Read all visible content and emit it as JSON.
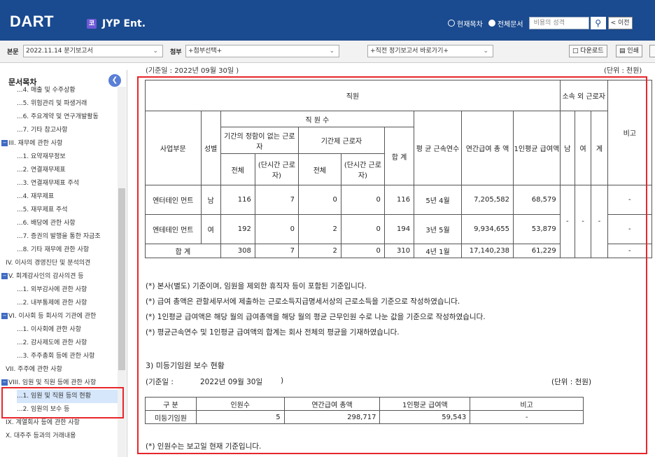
{
  "header": {
    "logo": "DART",
    "company": "JYP Ent.",
    "company_icon": "코",
    "radio1": "현재목차",
    "radio2": "전체문서",
    "search_placeholder": "비용의 성격",
    "prev_label": "< 이전"
  },
  "toolbar": {
    "main_label": "본문",
    "main_value": "2022.11.14  분기보고서",
    "attach_label": "첨부",
    "attach_value": "+첨부선택+",
    "recent_value": "+직전 정기보고서 바로가기+",
    "download": "다운로드",
    "print": "인쇄"
  },
  "sidebar": {
    "title": "문서목차",
    "items": [
      "...4. 매출 및 수주상황",
      "...5. 위험관리 및 파생거래",
      "...6. 주요계약 및 연구개발활동",
      "...7. 기타 참고사항",
      "III. 재무에 관한 사항",
      "...1. 요약재무정보",
      "...2. 연결재무제표",
      "...3. 연결재무제표 주석",
      "...4. 재무제표",
      "...5. 재무제표 주석",
      "...6. 배당에 관한 사항",
      "...7. 증권의 발행을 통한 자금조",
      "...8. 기타 재무에 관한 사항",
      "IV. 이사의 경영진단 및 분석의견",
      "V. 회계감사인의 감사의견 등",
      "...1. 외부감사에 관한 사항",
      "...2. 내부통제에 관한 사항",
      "VI. 이사회 등 회사의 기관에 관한",
      "...1. 이사회에 관한 사항",
      "...2. 감사제도에 관한 사항",
      "...3. 주주총회 등에 관한 사항",
      "VII. 주주에 관한 사항",
      "VIII. 임원 및 직원 등에 관한 사항",
      "...1. 임원 및 직원 등의 현황",
      "...2. 임원의 보수 등",
      "IX. 계열회사 등에 관한 사항",
      "X. 대주주 등과의 거래내용"
    ]
  },
  "top_partial": {
    "left": "(기준일 :  2022년 09월 30일 )",
    "right": "(단위 : 천원)"
  },
  "staff": {
    "h_staff": "직원",
    "h_outside": "소속 외 근로자",
    "h_remark": "비고",
    "h_count": "직 원 수",
    "h_div": "사업부문",
    "h_gender": "성별",
    "h_nofixed": "기간의 정함이 없는 근로자",
    "h_fixed": "기간제 근로자",
    "h_total": "합 계",
    "h_tenure": "평 균 근속연수",
    "h_annual": "연간급여 총 액",
    "h_avg": "1인평균 급여액",
    "h_male": "남",
    "h_female": "여",
    "h_sum": "계",
    "h_all": "전체",
    "h_part": "(단시간 근로자)",
    "rows": [
      {
        "div": "엔터테인 먼트",
        "gender": "남",
        "nf_all": "116",
        "nf_part": "7",
        "f_all": "0",
        "f_part": "0",
        "total": "116",
        "tenure": "5년 4월",
        "annual": "7,205,582",
        "avg": "68,579",
        "remark": "-"
      },
      {
        "div": "엔테테인 먼트",
        "gender": "여",
        "nf_all": "192",
        "nf_part": "0",
        "f_all": "2",
        "f_part": "0",
        "total": "194",
        "tenure": "3년 5월",
        "annual": "9,934,655",
        "avg": "53,879",
        "remark": "-"
      }
    ],
    "outside_vals": [
      "-",
      "-",
      "-"
    ],
    "sum_row": {
      "label": "합 계",
      "nf_all": "308",
      "nf_part": "7",
      "f_all": "2",
      "f_part": "0",
      "total": "310",
      "tenure": "4년 1월",
      "annual": "17,140,238",
      "avg": "61,229",
      "remark": "-"
    }
  },
  "notes": [
    "(*) 본사(별도) 기준이며, 임원을 제외한 휴직자 등이 포함된 기준입니다.",
    "(*) 급여 총액은 관할세무서에 제출하는 근로소득지급명세서상의 근로소득을 기준으로 작성하였습니다.",
    "(*) 1인평균 급여액은 해당 월의 급여총액을 해당 월의 평균 근무인원 수로 나눈 값을 기준으로 작성하였습니다.",
    "(*)  평균근속연수 및 1인평균 급여액의 합계는 회사 전체의 평균을 기재하였습니다."
  ],
  "section3": {
    "title": "3) 미등기임원 보수 현황",
    "date_label": "(기준일 :",
    "date_value": "2022년 09월 30일",
    "date_close": ")",
    "unit": "(단위 : 천원)",
    "headers": [
      "구 분",
      "인원수",
      "연간급여 총액",
      "1인평균 급여액",
      "비고"
    ],
    "row": [
      "미등기임원",
      "5",
      "298,717",
      "59,543",
      "-"
    ],
    "footnote": "(*) 인원수는 보고일 현재 기준입니다."
  }
}
